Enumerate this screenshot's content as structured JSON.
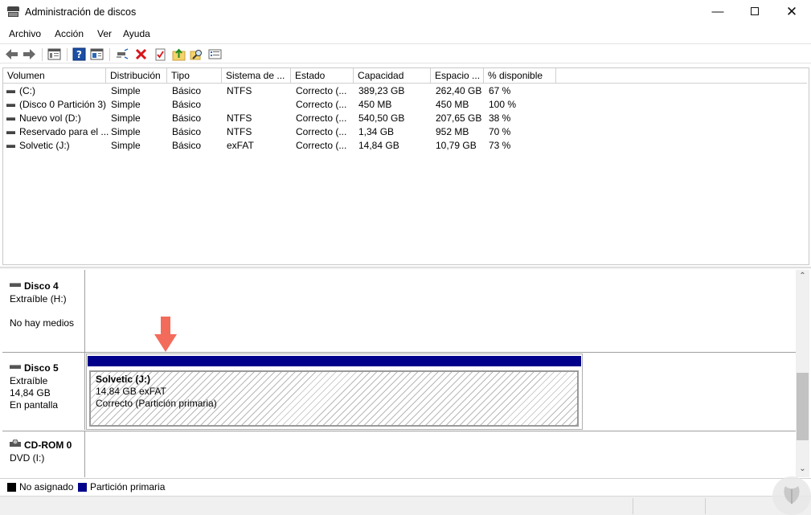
{
  "window": {
    "title": "Administración de discos"
  },
  "menu": [
    "Archivo",
    "Acción",
    "Ver",
    "Ayuda"
  ],
  "toolbar": {
    "icons": [
      "back-icon",
      "forward-icon",
      "console-tree-icon",
      "help-icon",
      "properties-icon",
      "connect-icon",
      "delete-icon",
      "checklist-icon",
      "upload-folder-icon",
      "search-folder-icon",
      "list-view-icon"
    ]
  },
  "volumes": {
    "columns": [
      "Volumen",
      "Distribución",
      "Tipo",
      "Sistema de ...",
      "Estado",
      "Capacidad",
      "Espacio ...",
      "% disponible"
    ],
    "rows": [
      [
        "(C:)",
        "Simple",
        "Básico",
        "NTFS",
        "Correcto (...",
        "389,23 GB",
        "262,40 GB",
        "67 %"
      ],
      [
        "(Disco 0 Partición 3)",
        "Simple",
        "Básico",
        "",
        "Correcto (...",
        "450 MB",
        "450 MB",
        "100 %"
      ],
      [
        "Nuevo vol (D:)",
        "Simple",
        "Básico",
        "NTFS",
        "Correcto (...",
        "540,50 GB",
        "207,65 GB",
        "38 %"
      ],
      [
        "Reservado para el ...",
        "Simple",
        "Básico",
        "NTFS",
        "Correcto (...",
        "1,34 GB",
        "952 MB",
        "70 %"
      ],
      [
        "Solvetic (J:)",
        "Simple",
        "Básico",
        "exFAT",
        "Correcto (...",
        "14,84 GB",
        "10,79 GB",
        "73 %"
      ]
    ]
  },
  "disks": {
    "disk4": {
      "name": "Disco 4",
      "type": "Extraíble (H:)",
      "status": "No hay medios"
    },
    "disk5": {
      "name": "Disco 5",
      "type": "Extraíble",
      "size": "14,84 GB",
      "status": "En pantalla"
    },
    "cdrom0": {
      "name": "CD-ROM 0",
      "type": "DVD (I:)"
    },
    "partition": {
      "name": "Solvetic  (J:)",
      "size": "14,84 GB exFAT",
      "status": "Correcto (Partición primaria)"
    }
  },
  "legend": {
    "unallocated": "No asignado",
    "primary": "Partición primaria"
  },
  "colors": {
    "primary_partition": "#00008b",
    "unallocated": "#000000",
    "arrow": "#f26b5b"
  }
}
